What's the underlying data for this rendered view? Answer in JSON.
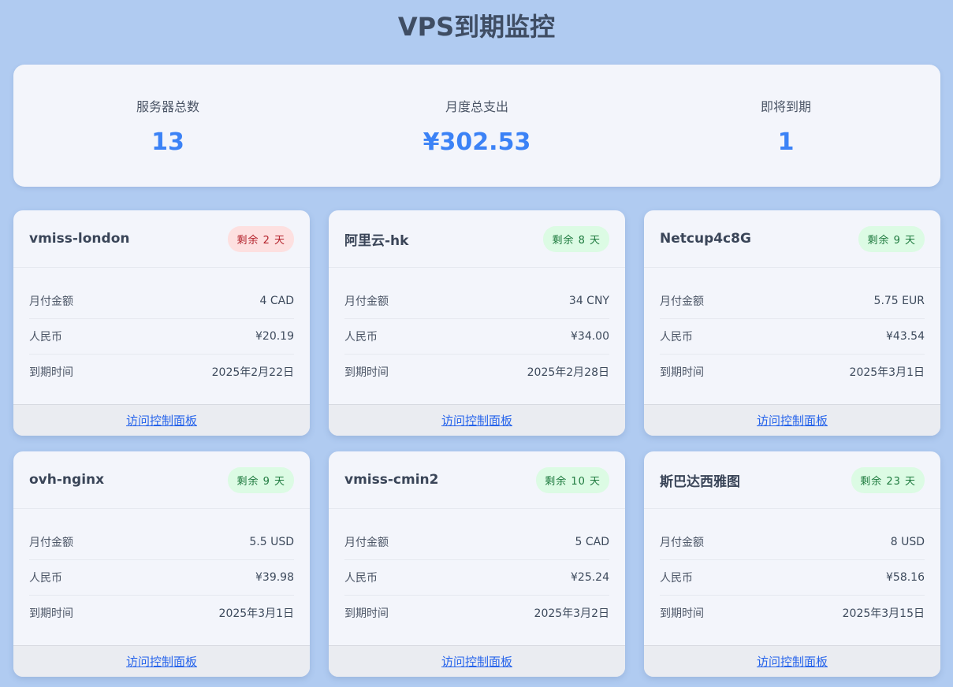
{
  "title": "VPS到期监控",
  "stats": {
    "server_count_label": "服务器总数",
    "server_count_value": "13",
    "monthly_total_label": "月度总支出",
    "monthly_total_value": "¥302.53",
    "expiring_label": "即将到期",
    "expiring_value": "1"
  },
  "labels": {
    "monthly": "月付金额",
    "rmb": "人民币",
    "expiry": "到期时间",
    "panel_link": "访问控制面板"
  },
  "servers": [
    {
      "name": "vmiss-london",
      "badge": "剩余 2 天",
      "status": "warn",
      "monthly": "4 CAD",
      "rmb": "¥20.19",
      "expiry": "2025年2月22日"
    },
    {
      "name": "阿里云-hk",
      "badge": "剩余 8 天",
      "status": "ok",
      "monthly": "34 CNY",
      "rmb": "¥34.00",
      "expiry": "2025年2月28日"
    },
    {
      "name": "Netcup4c8G",
      "badge": "剩余 9 天",
      "status": "ok",
      "monthly": "5.75 EUR",
      "rmb": "¥43.54",
      "expiry": "2025年3月1日"
    },
    {
      "name": "ovh-nginx",
      "badge": "剩余 9 天",
      "status": "ok",
      "monthly": "5.5 USD",
      "rmb": "¥39.98",
      "expiry": "2025年3月1日"
    },
    {
      "name": "vmiss-cmin2",
      "badge": "剩余 10 天",
      "status": "ok",
      "monthly": "5 CAD",
      "rmb": "¥25.24",
      "expiry": "2025年3月2日"
    },
    {
      "name": "斯巴达西雅图",
      "badge": "剩余 23 天",
      "status": "ok",
      "monthly": "8 USD",
      "rmb": "¥58.16",
      "expiry": "2025年3月15日"
    }
  ]
}
